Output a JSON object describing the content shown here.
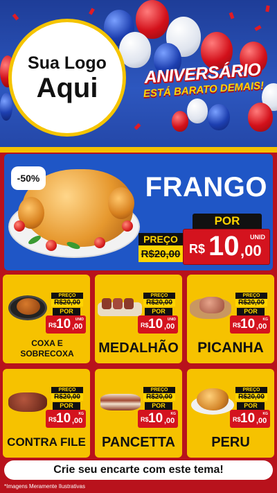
{
  "header": {
    "logo_line1": "Sua Logo",
    "logo_line2": "Aqui",
    "anniversary_title": "ANIVERSÁRIO",
    "anniversary_subtitle": "ESTÁ BARATO DEMAIS!"
  },
  "feature": {
    "discount": "-50%",
    "name": "FRANGO",
    "preco_label": "PREÇO",
    "old_price": "R$20,00",
    "por_label": "POR",
    "currency": "R$",
    "price_int": "10",
    "price_dec": ",00",
    "unit": "UNID"
  },
  "products": [
    {
      "name": "COXA E SOBRECOXA",
      "preco_label": "PREÇO",
      "old_price": "R$20,00",
      "por_label": "POR",
      "currency": "R$",
      "price_int": "10",
      "price_dec": ",00",
      "unit": "UNID"
    },
    {
      "name": "MEDALHÃO",
      "preco_label": "PREÇO",
      "old_price": "R$20,00",
      "por_label": "POR",
      "currency": "R$",
      "price_int": "10",
      "price_dec": ",00",
      "unit": "UNID"
    },
    {
      "name": "PICANHA",
      "preco_label": "PREÇO",
      "old_price": "R$20,00",
      "por_label": "POR",
      "currency": "R$",
      "price_int": "10",
      "price_dec": ",00",
      "unit": "KG"
    },
    {
      "name": "CONTRA FILE",
      "preco_label": "PREÇO",
      "old_price": "R$20,00",
      "por_label": "POR",
      "currency": "R$",
      "price_int": "10",
      "price_dec": ",00",
      "unit": "KG"
    },
    {
      "name": "PANCETTA",
      "preco_label": "PREÇO",
      "old_price": "R$20,00",
      "por_label": "POR",
      "currency": "R$",
      "price_int": "10",
      "price_dec": ",00",
      "unit": "KG"
    },
    {
      "name": "PERU",
      "preco_label": "PREÇO",
      "old_price": "R$20,00",
      "por_label": "POR",
      "currency": "R$",
      "price_int": "10",
      "price_dec": ",00",
      "unit": "KG"
    }
  ],
  "footer": {
    "cta": "Crie seu encarte com este tema!",
    "disclaimer": "*Imagens Meramente Ilustrativas"
  },
  "colors": {
    "header_blue": "#1e3d98",
    "panel_blue": "#1f56c6",
    "card_yellow": "#f6c200",
    "price_red": "#d4131e",
    "background_red": "#b8121c"
  }
}
